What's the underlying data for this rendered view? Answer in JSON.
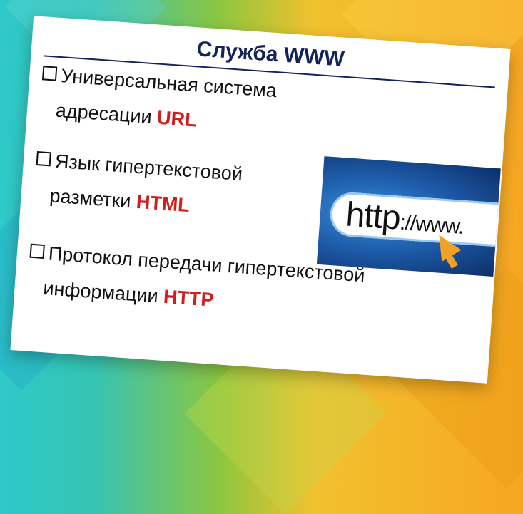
{
  "slide": {
    "title": "Служба WWW",
    "items": [
      {
        "text_line1": "Универсальная система",
        "text_line2": "адресации",
        "highlight": "URL"
      },
      {
        "text_line1": "Язык гипертекстовой",
        "text_line2": "разметки",
        "highlight": "HTML"
      },
      {
        "text_line1": "Протокол передачи гипертекстовой",
        "text_line2": "информации",
        "highlight": "HTTP"
      }
    ],
    "image": {
      "big_text": "http",
      "small_text": "://www."
    }
  },
  "colors": {
    "title": "#14235c",
    "highlight": "#d21d1d",
    "cursor": "#f0a12a"
  }
}
